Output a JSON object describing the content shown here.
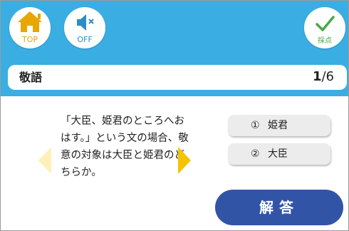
{
  "header": {
    "top_button": {
      "label": "TOP",
      "icon": "home-icon"
    },
    "sound_button": {
      "label": "OFF",
      "icon": "speaker-muted-icon"
    },
    "grade_button": {
      "label": "採点",
      "icon": "checkmark-icon"
    }
  },
  "title_bar": {
    "title": "敬語",
    "current": "1",
    "total": "/6"
  },
  "question": {
    "text": "「大臣、姫君のところへおはす。」という文の場合、敬意の対象は大臣と姫君のどちらか。"
  },
  "navigation": {
    "prev_icon": "arrow-left-icon",
    "next_icon": "arrow-right-icon"
  },
  "choices": [
    {
      "num": "①",
      "label": "姫君"
    },
    {
      "num": "②",
      "label": "大臣"
    }
  ],
  "answer_button": {
    "label": "解答"
  },
  "colors": {
    "header_bg": "#3aaee2",
    "answer_bg": "#3254a6",
    "arrow_next": "#f4c400",
    "arrow_prev": "#fdf0b8",
    "top_icon": "#e8a600",
    "check_icon": "#4aa64a"
  }
}
